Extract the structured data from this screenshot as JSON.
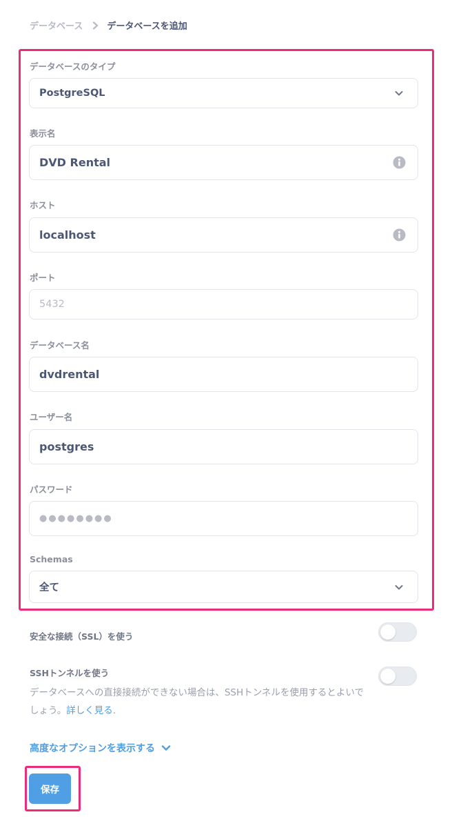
{
  "breadcrumb": {
    "root": "データベース",
    "current": "データベースを追加"
  },
  "form": {
    "db_type": {
      "label": "データベースのタイプ",
      "value": "PostgreSQL"
    },
    "display_name": {
      "label": "表示名",
      "value": "DVD Rental"
    },
    "host": {
      "label": "ホスト",
      "value": "localhost"
    },
    "port": {
      "label": "ポート",
      "placeholder": "5432"
    },
    "db_name": {
      "label": "データベース名",
      "value": "dvdrental"
    },
    "username": {
      "label": "ユーザー名",
      "value": "postgres"
    },
    "password": {
      "label": "パスワード",
      "masked": "●●●●●●●●"
    },
    "schemas": {
      "label": "Schemas",
      "value": "全て"
    }
  },
  "ssl": {
    "label": "安全な接続（SSL）を使う",
    "enabled": false
  },
  "ssh": {
    "label": "SSHトンネルを使う",
    "enabled": false,
    "description": "データベースへの直接接続ができない場合は、SSHトンネルを使用するとよいでしょう。",
    "learn_more": "詳しく見る",
    "period": "."
  },
  "advanced": {
    "label": "高度なオプションを表示する"
  },
  "save": {
    "label": "保存"
  },
  "colors": {
    "accent": "#509ee3",
    "highlight": "#ec2c7a",
    "text": "#4c5773",
    "muted": "#b8bbc3"
  },
  "icons": {
    "separator": "chevron-right-icon",
    "select": "chevron-down-icon",
    "info": "info-icon"
  }
}
